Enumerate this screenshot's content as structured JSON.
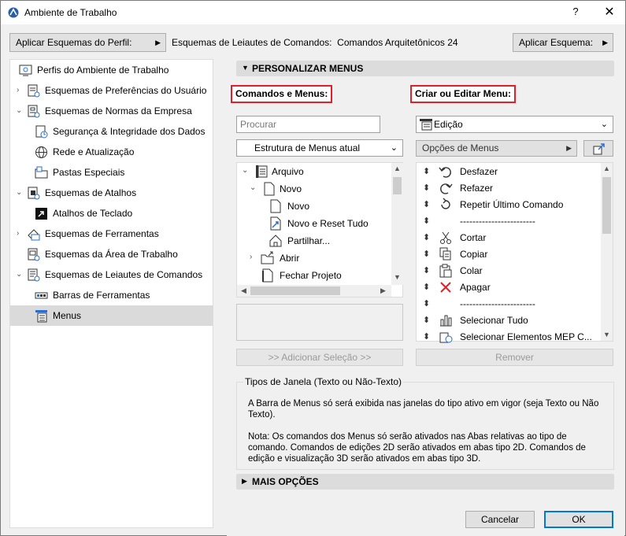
{
  "window": {
    "title": "Ambiente de Trabalho",
    "help_label": "?",
    "close_label": "✕"
  },
  "topbar": {
    "apply_profile_label": "Aplicar Esquemas do Perfil:",
    "path_label": "Esquemas de Leiautes de Comandos",
    "path_value": "Comandos Arquitetônicos 24",
    "apply_scheme_label": "Aplicar Esquema:"
  },
  "sidebar": {
    "items": [
      {
        "label": "Perfis do Ambiente de Trabalho",
        "icon": "profiles-icon"
      },
      {
        "label": "Esquemas de Preferências do Usuário",
        "icon": "user-preferences-icon"
      },
      {
        "label": "Esquemas de Normas da Empresa",
        "icon": "company-standards-icon"
      },
      {
        "label": "Segurança & Integridade dos Dados",
        "icon": "data-safety-icon"
      },
      {
        "label": "Rede e Atualização",
        "icon": "network-globe-icon"
      },
      {
        "label": "Pastas Especiais",
        "icon": "special-folders-icon"
      },
      {
        "label": "Esquemas de Atalhos",
        "icon": "shortcut-schemes-icon"
      },
      {
        "label": "Atalhos de Teclado",
        "icon": "keyboard-shortcuts-icon"
      },
      {
        "label": "Esquemas de Ferramentas",
        "icon": "tool-schemes-icon"
      },
      {
        "label": "Esquemas da Área de Trabalho",
        "icon": "work-environment-icon"
      },
      {
        "label": "Esquemas de Leiautes de Comandos",
        "icon": "command-layout-icon"
      },
      {
        "label": "Barras de Ferramentas",
        "icon": "toolbars-icon"
      },
      {
        "label": "Menus",
        "icon": "menus-icon"
      }
    ]
  },
  "main": {
    "section_title": "PERSONALIZAR MENUS",
    "commands_menus_label": "Comandos e Menus:",
    "create_edit_label": "Criar ou Editar Menu:",
    "search_placeholder": "Procurar",
    "structure_select": "Estrutura de Menus atual",
    "menu_select": "Edição",
    "menu_options_label": "Opções de Menus",
    "left_tree": [
      {
        "label": "Arquivo"
      },
      {
        "label": "Novo"
      },
      {
        "label": "Novo"
      },
      {
        "label": "Novo e Reset Tudo"
      },
      {
        "label": "Partilhar..."
      },
      {
        "label": "Abrir"
      },
      {
        "label": "Fechar Projeto"
      }
    ],
    "right_list": [
      {
        "label": "Desfazer"
      },
      {
        "label": "Refazer"
      },
      {
        "label": "Repetir Último Comando"
      },
      {
        "label": "------------------------"
      },
      {
        "label": "Cortar"
      },
      {
        "label": "Copiar"
      },
      {
        "label": "Colar"
      },
      {
        "label": "Apagar"
      },
      {
        "label": "------------------------"
      },
      {
        "label": "Selecionar Tudo"
      },
      {
        "label": "Selecionar Elementos MEP C..."
      }
    ],
    "add_selection_label": ">> Adicionar Seleção >>",
    "remove_label": "Remover",
    "info_legend": "Tipos de Janela (Texto ou Não-Texto)",
    "info_p1": "A Barra de Menus só será exibida nas janelas do tipo ativo em vigor (seja Texto ou Não Texto).",
    "info_p2": "Nota: Os comandos dos Menus só serão ativados nas Abas relativas ao tipo de comando. Comandos de edições 2D serão ativados em abas tipo 2D. Comandos de edição e visualização 3D serão ativados em abas tipo 3D.",
    "more_options_label": "MAIS OPÇÕES"
  },
  "footer": {
    "cancel_label": "Cancelar",
    "ok_label": "OK"
  },
  "colors": {
    "highlight_border": "#e0202a",
    "selected_row": "#dadada",
    "ok_border": "#0078d7"
  }
}
